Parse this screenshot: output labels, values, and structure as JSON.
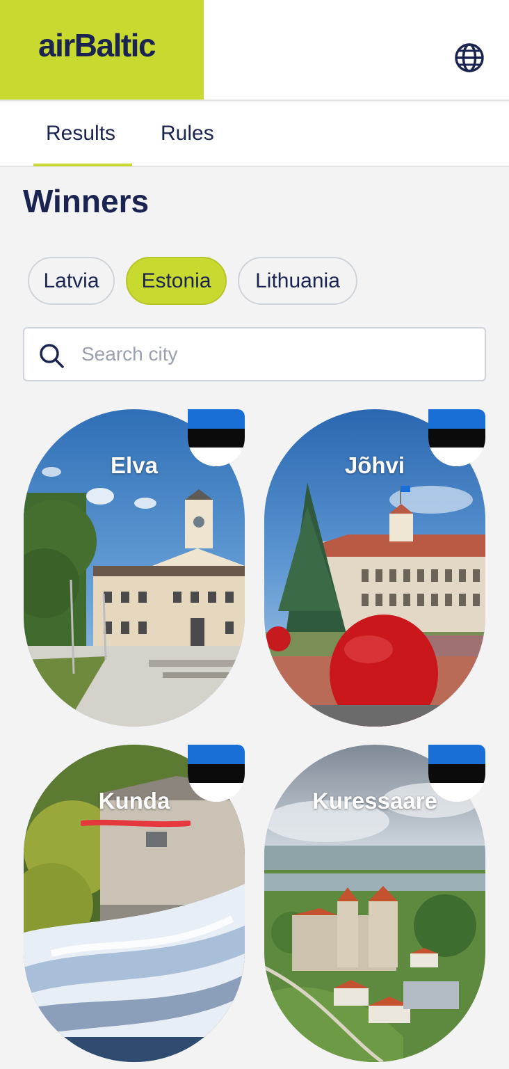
{
  "header": {
    "logo_text": "airBaltic",
    "globe_icon": "globe-icon"
  },
  "tabs": [
    {
      "label": "Results",
      "active": true
    },
    {
      "label": "Rules",
      "active": false
    }
  ],
  "page": {
    "title": "Winners"
  },
  "country_filters": [
    {
      "label": "Latvia",
      "selected": false
    },
    {
      "label": "Estonia",
      "selected": true
    },
    {
      "label": "Lithuania",
      "selected": false
    }
  ],
  "search": {
    "placeholder": "Search city",
    "value": "",
    "icon": "search-icon"
  },
  "cities": [
    {
      "name": "Elva",
      "flag": "estonia-flag-icon"
    },
    {
      "name": "Jõhvi",
      "flag": "estonia-flag-icon"
    },
    {
      "name": "Kunda",
      "flag": "estonia-flag-icon"
    },
    {
      "name": "Kuressaare",
      "flag": "estonia-flag-icon"
    }
  ],
  "colors": {
    "accent": "#c8d92f",
    "navy": "#1b2450",
    "flag_blue": "#1a6fd6",
    "flag_black": "#0b0b0b"
  }
}
